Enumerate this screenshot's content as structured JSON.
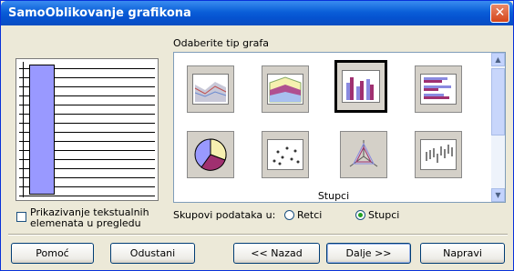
{
  "window": {
    "title": "SamoOblikovanje grafikona",
    "close_glyph": "✕"
  },
  "chart_type_group": {
    "label": "Odaberite tip grafa",
    "selected_name": "Stupci"
  },
  "chart_types": [
    {
      "id": "area",
      "selected": false
    },
    {
      "id": "area-3d",
      "selected": false
    },
    {
      "id": "column",
      "selected": true
    },
    {
      "id": "bar",
      "selected": false
    },
    {
      "id": "pie",
      "selected": false
    },
    {
      "id": "xy-scatter",
      "selected": false
    },
    {
      "id": "net",
      "selected": false
    },
    {
      "id": "stock",
      "selected": false
    }
  ],
  "preview": {
    "show_text_label": "Prikazivanje tekstualnih elemenata u pregledu",
    "checked": false
  },
  "data_series": {
    "label": "Skupovi podataka u:",
    "options": [
      {
        "label": "Retci",
        "selected": false
      },
      {
        "label": "Stupci",
        "selected": true
      }
    ]
  },
  "buttons": {
    "help": "Pomoć",
    "cancel": "Odustani",
    "back": "<< Nazad",
    "next": "Dalje >>",
    "create": "Napravi"
  },
  "colors": {
    "title_bar": "#0a5fd8",
    "preview_bar": "#9999ff",
    "dialog_bg": "#ece9d8"
  }
}
